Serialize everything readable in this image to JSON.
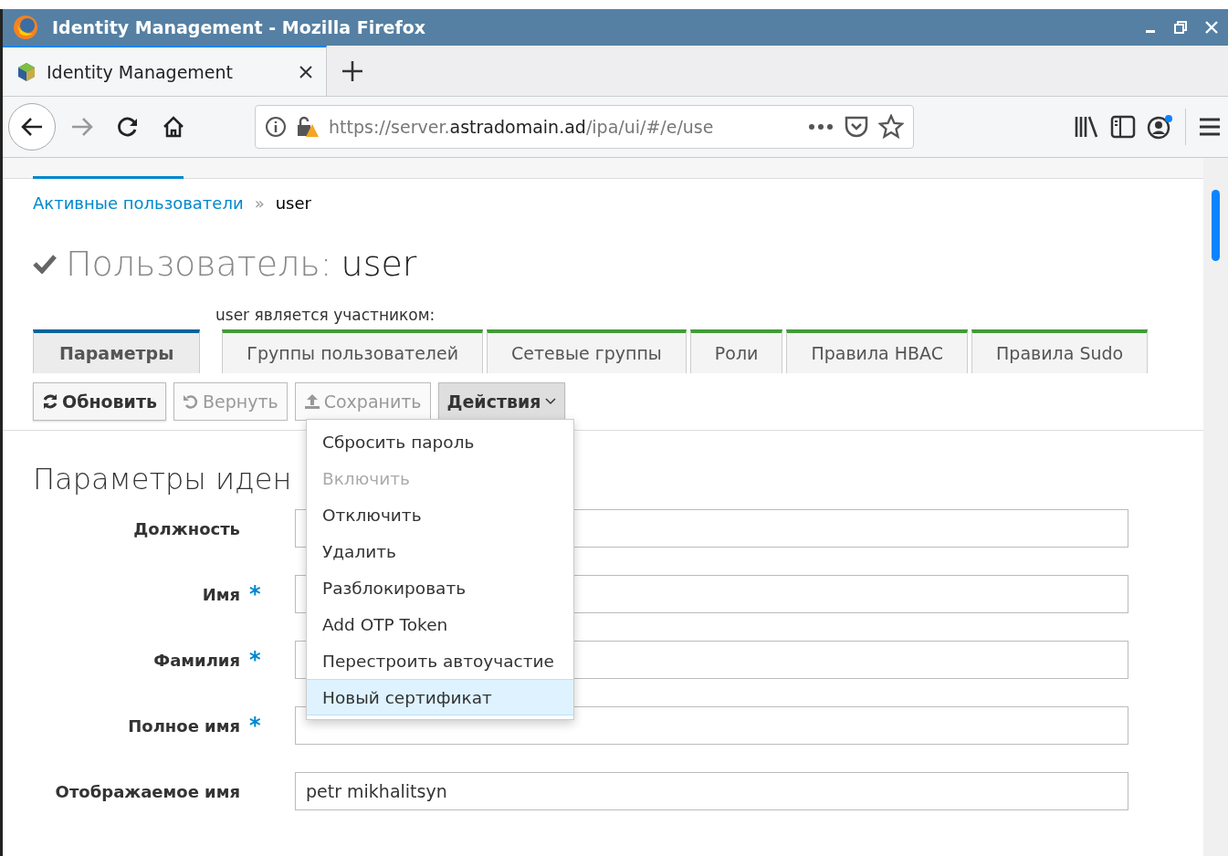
{
  "window": {
    "title": "Identity Management - Mozilla Firefox"
  },
  "browser_tab": {
    "title": "Identity Management"
  },
  "address_bar": {
    "url_scheme": "https://server.",
    "url_domain": "astradomain.ad",
    "url_path": "/ipa/ui/#/e/use"
  },
  "breadcrumb": {
    "link": "Активные пользователи",
    "separator": "»",
    "current": "user"
  },
  "page_title": {
    "prefix": "Пользователь:",
    "name": "user"
  },
  "member_label": "user является участником:",
  "facet_tabs": [
    {
      "label": "Параметры",
      "kind": "settings",
      "selected": true
    },
    {
      "label": "Группы пользователей",
      "kind": "member",
      "selected": false
    },
    {
      "label": "Сетевые группы",
      "kind": "member",
      "selected": false
    },
    {
      "label": "Роли",
      "kind": "member",
      "selected": false
    },
    {
      "label": "Правила HBAC",
      "kind": "member",
      "selected": false
    },
    {
      "label": "Правила Sudo",
      "kind": "member",
      "selected": false
    }
  ],
  "action_buttons": [
    {
      "label": "Обновить",
      "kind": "refresh",
      "disabled": false,
      "expanded": false
    },
    {
      "label": "Вернуть",
      "kind": "revert",
      "disabled": true,
      "expanded": false
    },
    {
      "label": "Сохранить",
      "kind": "save",
      "disabled": true,
      "expanded": false
    },
    {
      "label": "Действия",
      "kind": "dropdown",
      "disabled": false,
      "expanded": true
    }
  ],
  "actions_menu": [
    {
      "label": "Сбросить пароль",
      "disabled": false,
      "selected": false
    },
    {
      "label": "Включить",
      "disabled": true,
      "selected": false
    },
    {
      "label": "Отключить",
      "disabled": false,
      "selected": false
    },
    {
      "label": "Удалить",
      "disabled": false,
      "selected": false
    },
    {
      "label": "Разблокировать",
      "disabled": false,
      "selected": false
    },
    {
      "label": "Add OTP Token",
      "disabled": false,
      "selected": false
    },
    {
      "label": "Перестроить автоучастие",
      "disabled": false,
      "selected": false
    },
    {
      "label": "Новый сертификат",
      "disabled": false,
      "selected": true
    }
  ],
  "section_title": "Параметры иден",
  "fields": [
    {
      "label": "Должность"
    },
    {
      "label": "Имя",
      "required_mark": "*"
    },
    {
      "label": "Фамилия",
      "required_mark": "*"
    },
    {
      "label": "Полное имя",
      "required_mark": "*"
    },
    {
      "label": "Отображаемое имя",
      "value": "petr mikhalitsyn"
    }
  ]
}
